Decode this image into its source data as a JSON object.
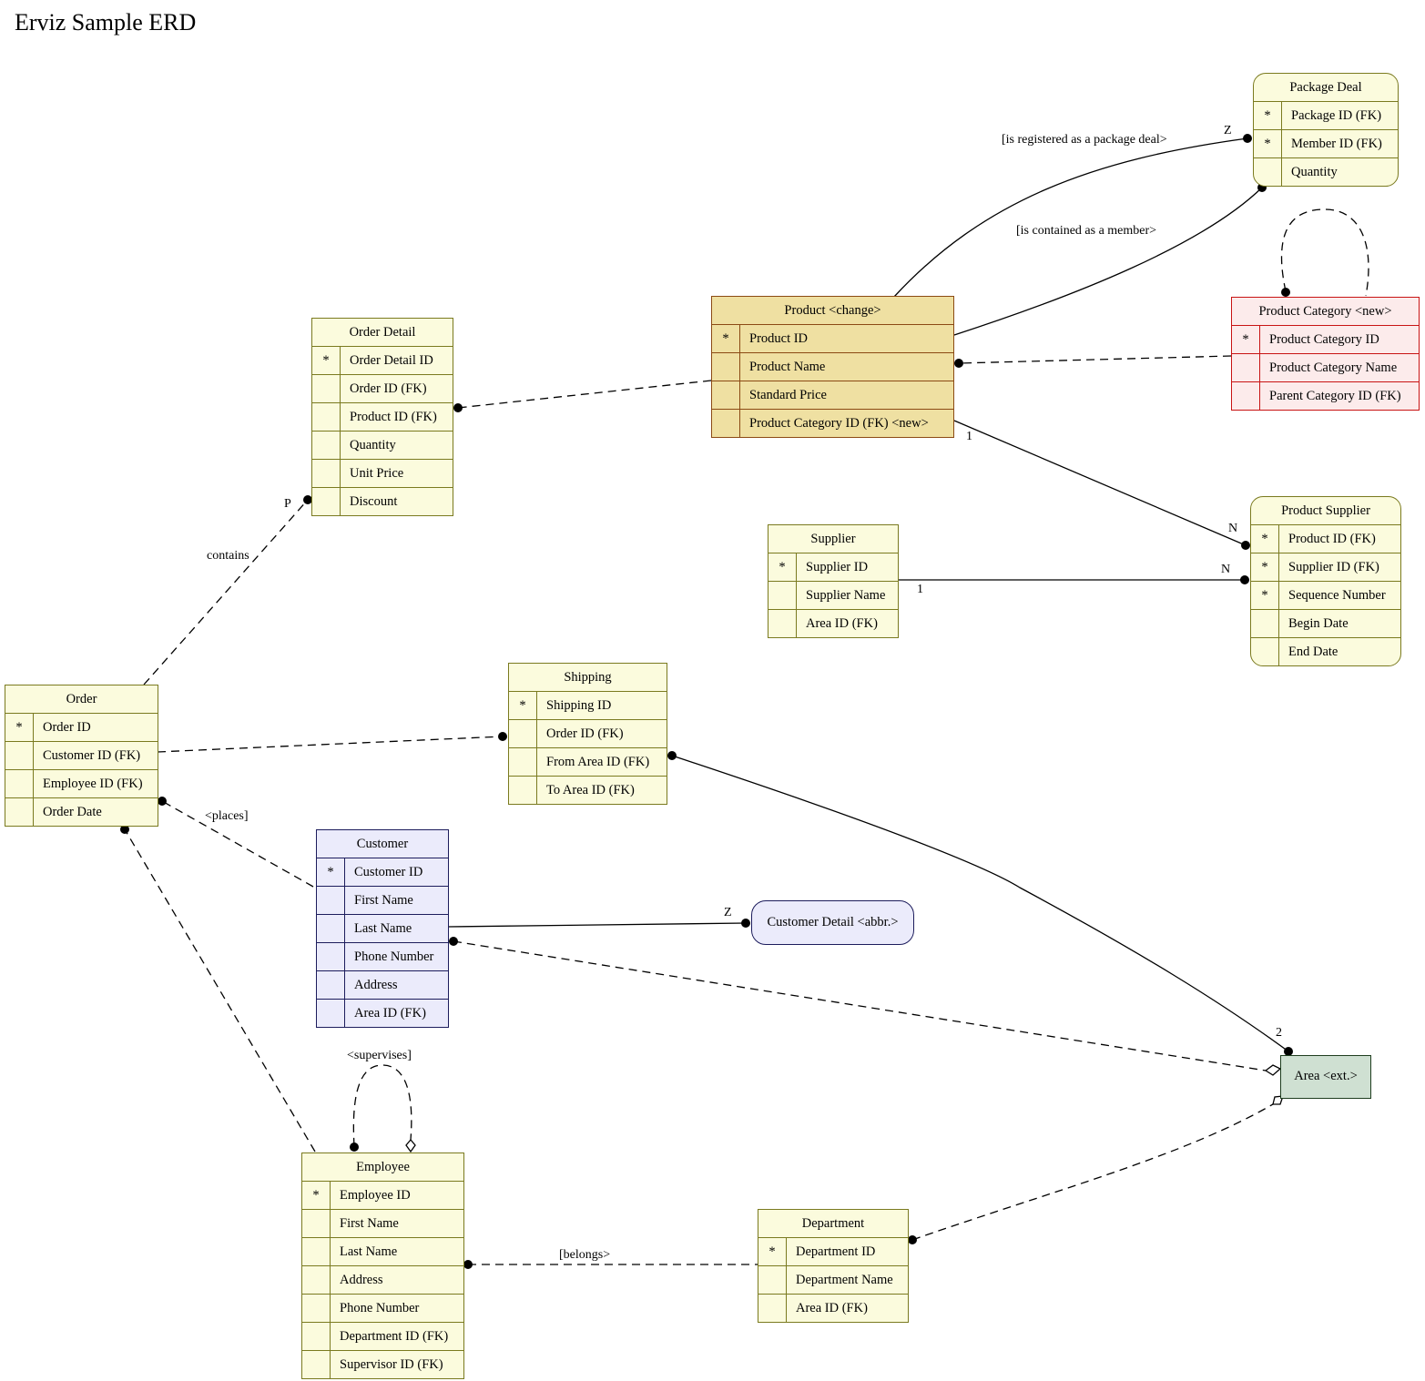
{
  "title": "Erviz Sample ERD",
  "colors": {
    "default_fill": "#fbfbdd",
    "default_border": "#7a7a1f",
    "changed_fill": "#efe0a2",
    "changed_border": "#8b4a14",
    "new_fill": "#fcebeb",
    "new_border": "#c81414",
    "customer_fill": "#ebebfb",
    "customer_border": "#1c1c5c",
    "external_fill": "#cfe0d2",
    "external_border": "#1e3d1e"
  },
  "entities": {
    "package_deal": {
      "title": "Package Deal",
      "attributes": [
        {
          "key": "*",
          "name": "Package ID (FK)"
        },
        {
          "key": "*",
          "name": "Member ID (FK)"
        },
        {
          "key": "",
          "name": "Quantity"
        }
      ]
    },
    "product": {
      "title": "Product  <change>",
      "attributes": [
        {
          "key": "*",
          "name": "Product ID"
        },
        {
          "key": "",
          "name": "Product Name"
        },
        {
          "key": "",
          "name": "Standard Price"
        },
        {
          "key": "",
          "name": "Product Category ID (FK)  <new>"
        }
      ]
    },
    "product_category": {
      "title": "Product Category  <new>",
      "attributes": [
        {
          "key": "*",
          "name": "Product Category ID"
        },
        {
          "key": "",
          "name": "Product Category Name"
        },
        {
          "key": "",
          "name": "Parent Category ID (FK)"
        }
      ]
    },
    "order_detail": {
      "title": "Order Detail",
      "attributes": [
        {
          "key": "*",
          "name": "Order Detail ID"
        },
        {
          "key": "",
          "name": "Order ID (FK)"
        },
        {
          "key": "",
          "name": "Product ID (FK)"
        },
        {
          "key": "",
          "name": "Quantity"
        },
        {
          "key": "",
          "name": "Unit Price"
        },
        {
          "key": "",
          "name": "Discount"
        }
      ]
    },
    "supplier": {
      "title": "Supplier",
      "attributes": [
        {
          "key": "*",
          "name": "Supplier ID"
        },
        {
          "key": "",
          "name": "Supplier Name"
        },
        {
          "key": "",
          "name": "Area ID (FK)"
        }
      ]
    },
    "product_supplier": {
      "title": "Product Supplier",
      "attributes": [
        {
          "key": "*",
          "name": "Product ID (FK)"
        },
        {
          "key": "*",
          "name": "Supplier ID (FK)"
        },
        {
          "key": "*",
          "name": "Sequence Number"
        },
        {
          "key": "",
          "name": "Begin Date"
        },
        {
          "key": "",
          "name": "End Date"
        }
      ]
    },
    "order": {
      "title": "Order",
      "attributes": [
        {
          "key": "*",
          "name": "Order ID"
        },
        {
          "key": "",
          "name": "Customer ID (FK)"
        },
        {
          "key": "",
          "name": "Employee ID (FK)"
        },
        {
          "key": "",
          "name": "Order Date"
        }
      ]
    },
    "shipping": {
      "title": "Shipping",
      "attributes": [
        {
          "key": "*",
          "name": "Shipping ID"
        },
        {
          "key": "",
          "name": "Order ID (FK)"
        },
        {
          "key": "",
          "name": "From Area ID (FK)"
        },
        {
          "key": "",
          "name": "To Area ID (FK)"
        }
      ]
    },
    "customer": {
      "title": "Customer",
      "attributes": [
        {
          "key": "*",
          "name": "Customer ID"
        },
        {
          "key": "",
          "name": "First Name"
        },
        {
          "key": "",
          "name": "Last Name"
        },
        {
          "key": "",
          "name": "Phone Number"
        },
        {
          "key": "",
          "name": "Address"
        },
        {
          "key": "",
          "name": "Area ID (FK)"
        }
      ]
    },
    "customer_detail": {
      "title": "Customer Detail  <abbr.>"
    },
    "area": {
      "title": "Area  <ext.>"
    },
    "employee": {
      "title": "Employee",
      "attributes": [
        {
          "key": "*",
          "name": "Employee ID"
        },
        {
          "key": "",
          "name": "First Name"
        },
        {
          "key": "",
          "name": "Last Name"
        },
        {
          "key": "",
          "name": "Address"
        },
        {
          "key": "",
          "name": "Phone Number"
        },
        {
          "key": "",
          "name": "Department ID (FK)"
        },
        {
          "key": "",
          "name": "Supervisor ID (FK)"
        }
      ]
    },
    "department": {
      "title": "Department",
      "attributes": [
        {
          "key": "*",
          "name": "Department ID"
        },
        {
          "key": "",
          "name": "Department Name"
        },
        {
          "key": "",
          "name": "Area ID (FK)"
        }
      ]
    }
  },
  "relationships": {
    "registered_package": {
      "label": "[is registered as a package deal>",
      "cardinality": "Z"
    },
    "contained_member": {
      "label": "[is contained as a member>"
    },
    "contains": {
      "label": "contains",
      "cardinality": "P"
    },
    "product_supplier_product": {
      "from_card": "1",
      "to_card": "N"
    },
    "supplier_product_supplier": {
      "from_card": "1",
      "to_card": "N"
    },
    "places": {
      "label": "<places]"
    },
    "customer_detail": {
      "cardinality": "Z"
    },
    "shipping_area": {
      "cardinality": "2"
    },
    "supervises": {
      "label": "<supervises]"
    },
    "belongs": {
      "label": "[belongs>"
    }
  }
}
